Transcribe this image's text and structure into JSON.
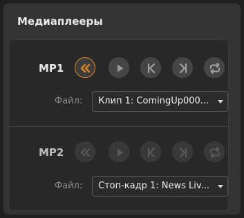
{
  "panel": {
    "title": "Медиаплееры"
  },
  "players": [
    {
      "label": "MP1",
      "label_color": "#e8e8e8",
      "file_label": "Файл:",
      "file_value": "Клип 1: ComingUp000...",
      "buttons": [
        "rewind-icon",
        "play-icon",
        "previous-frame-icon",
        "next-frame-icon",
        "loop-icon"
      ],
      "active_button": "rewind-icon"
    },
    {
      "label": "MP2",
      "label_color": "#bdbdbd",
      "file_label": "Файл:",
      "file_value": "Стоп-кадр 1: News Liv...",
      "buttons": [
        "rewind-icon",
        "play-icon",
        "previous-frame-icon",
        "next-frame-icon",
        "loop-icon"
      ],
      "disabled": true
    }
  ],
  "colors": {
    "accent": "#e0891f",
    "background": "#202020",
    "panel": "#333333"
  }
}
